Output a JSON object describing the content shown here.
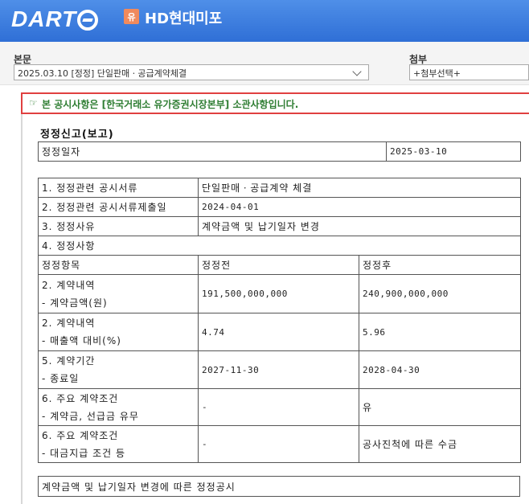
{
  "header": {
    "logo_text": "DART",
    "company_badge": "유",
    "company_name": "HD현대미포"
  },
  "toolbar": {
    "main_label": "본문",
    "main_selected": "2025.03.10 [정정] 단일판매ㆍ공급계약체결",
    "attach_label": "첨부",
    "attach_selected": "+첨부선택+"
  },
  "notice": {
    "icon": "pointing-hand-icon",
    "text": "본 공시사항은 [한국거래소 유가증권시장본부] 소관사항입니다."
  },
  "document": {
    "title": "정정신고(보고)",
    "date_table": {
      "label": "정정일자",
      "value": "2025-03-10"
    },
    "info_rows": [
      {
        "label": "1. 정정관련 공시서류",
        "value": "단일판매ㆍ공급계약 체결"
      },
      {
        "label": "2. 정정관련 공시서류제출일",
        "value": "2024-04-01"
      },
      {
        "label": "3. 정정사유",
        "value": "계약금액 및 납기일자 변경"
      }
    ],
    "section4_label": "4. 정정사항",
    "columns": [
      "정정항목",
      "정정전",
      "정정후"
    ],
    "change_rows": [
      {
        "item_line1": "2. 계약내역",
        "item_line2": "- 계약금액(원)",
        "before": "191,500,000,000",
        "after": "240,900,000,000"
      },
      {
        "item_line1": "2. 계약내역",
        "item_line2": "- 매출액 대비(%)",
        "before": "4.74",
        "after": "5.96"
      },
      {
        "item_line1": "5. 계약기간",
        "item_line2": "- 종료일",
        "before": "2027-11-30",
        "after": "2028-04-30"
      },
      {
        "item_line1": "6. 주요 계약조건",
        "item_line2": "- 계약금, 선급금 유무",
        "before": "-",
        "after": "유"
      },
      {
        "item_line1": "6. 주요 계약조건",
        "item_line2": "- 대금지급 조건 등",
        "before": "-",
        "after": "공사진척에 따른 수금"
      }
    ],
    "footer_note": "계약금액 및 납기일자 변경에 따른 정정공시"
  },
  "colors": {
    "header_blue": "#2f6fd6",
    "notice_border": "#e04040",
    "notice_text": "#2e7d32",
    "badge": "#f08a5d"
  }
}
